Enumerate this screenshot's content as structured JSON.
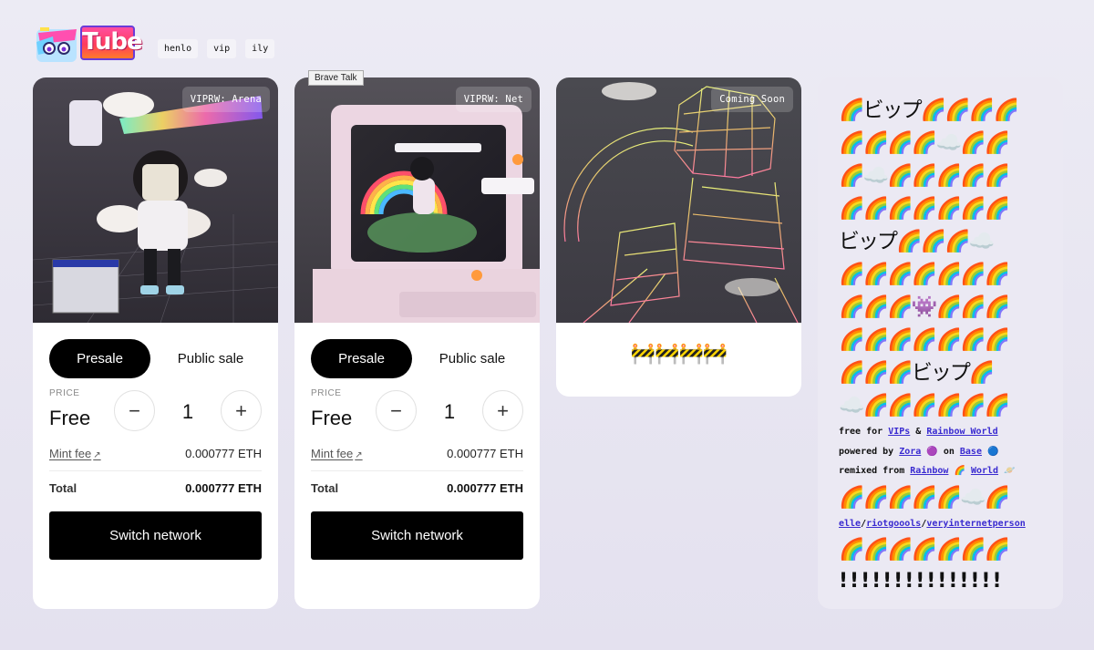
{
  "header": {
    "logo_text": "Tube",
    "nav": [
      "henlo",
      "vip",
      "ily"
    ]
  },
  "tooltip": "Brave Talk",
  "cards": [
    {
      "tag": "VIPRW: Arena",
      "presale_label": "Presale",
      "public_label": "Public sale",
      "price_label": "PRICE",
      "price_value": "Free",
      "quantity": "1",
      "minus": "−",
      "plus": "+",
      "mint_fee_label": "Mint fee",
      "mint_fee_value": "0.000777 ETH",
      "total_label": "Total",
      "total_value": "0.000777 ETH",
      "action_label": "Switch network"
    },
    {
      "tag": "VIPRW: Net",
      "presale_label": "Presale",
      "public_label": "Public sale",
      "price_label": "PRICE",
      "price_value": "Free",
      "quantity": "1",
      "minus": "−",
      "plus": "+",
      "mint_fee_label": "Mint fee",
      "mint_fee_value": "0.000777 ETH",
      "total_label": "Total",
      "total_value": "0.000777 ETH",
      "action_label": "Switch network"
    },
    {
      "tag": "Coming Soon",
      "construction": "🚧🚧🚧🚧"
    }
  ],
  "side": {
    "lines": [
      "🌈ビップ🌈🌈🌈🌈",
      "🌈🌈🌈🌈☁️🌈🌈",
      "🌈☁️🌈🌈🌈🌈🌈",
      "🌈🌈🌈🌈🌈🌈🌈",
      "ビップ🌈🌈🌈☁️",
      "🌈🌈🌈🌈🌈🌈🌈",
      "🌈🌈🌈👾🌈🌈🌈",
      "🌈🌈🌈🌈🌈🌈🌈",
      "🌈🌈🌈ビップ🌈",
      "☁️🌈🌈🌈🌈🌈🌈"
    ],
    "free_for": {
      "prefix": "free for ",
      "link1": "VIPs",
      "amp": " & ",
      "link2": "Rainbow World"
    },
    "powered": {
      "prefix": "powered by ",
      "link1": "Zora",
      "mid": " 🟣 on ",
      "link2": "Base",
      "suffix": " 🔵"
    },
    "remixed": {
      "prefix": "remixed from ",
      "link1": "Rainbow",
      "mid": " 🌈 ",
      "link2": "World",
      "suffix": " 🪐"
    },
    "line_after": "🌈🌈🌈🌈🌈☁️🌈",
    "credits": {
      "a": "elle",
      "b": "riotgoools",
      "c": "veryinternetperson",
      "sep": "/"
    },
    "line_last": "🌈🌈🌈🌈🌈🌈🌈",
    "exclaim": "!!!!!!!!!!!!!!!"
  }
}
